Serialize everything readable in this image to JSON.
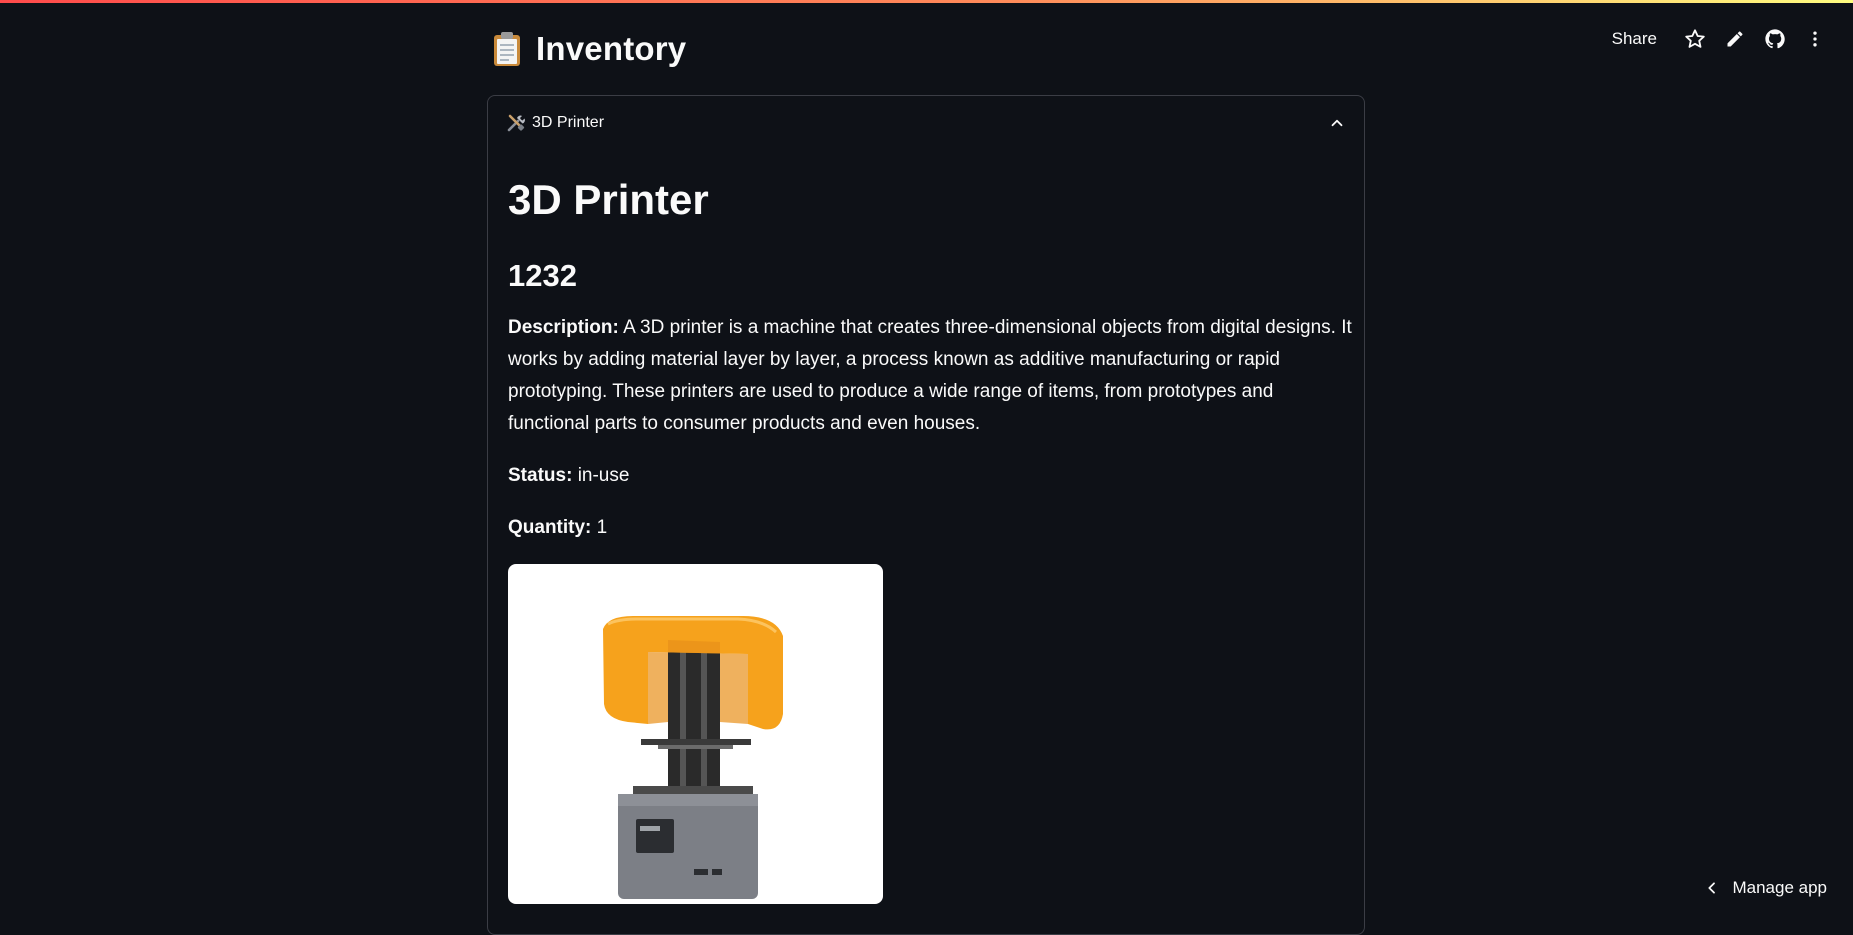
{
  "app": {
    "title": "Inventory",
    "accent_gradient": [
      "#ff4b4b",
      "#fffd80"
    ],
    "background": "#0e1117"
  },
  "toolbar": {
    "share_label": "Share",
    "icons": [
      "star-icon",
      "pencil-icon",
      "github-icon",
      "more-vert-icon"
    ]
  },
  "expander": {
    "label": "3D Printer",
    "icon": "tools-icon",
    "expanded": true
  },
  "item": {
    "title": "3D Printer",
    "id": "1232",
    "description_label": "Description:",
    "description": "A 3D printer is a machine that creates three-dimensional objects from digital designs. It works by adding material layer by layer, a process known as additive manufacturing or rapid prototyping. These printers are used to produce a wide range of items, from prototypes and functional parts to consumer products and even houses.",
    "status_label": "Status:",
    "status": "in-use",
    "quantity_label": "Quantity:",
    "quantity": "1",
    "image_alt": "resin 3D printer with orange UV cover"
  },
  "footer": {
    "manage_app_label": "Manage app"
  }
}
